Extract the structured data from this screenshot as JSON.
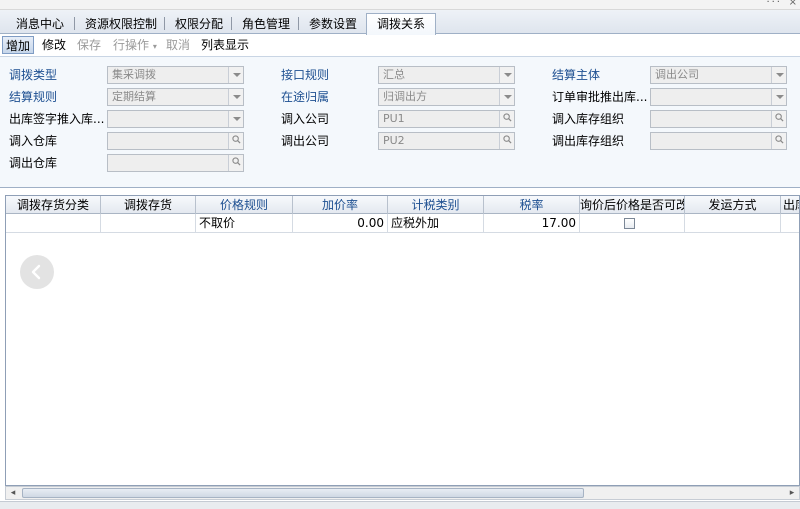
{
  "tabs": [
    {
      "label": "消息中心"
    },
    {
      "label": "资源权限控制"
    },
    {
      "label": "权限分配"
    },
    {
      "label": "角色管理"
    },
    {
      "label": "参数设置"
    },
    {
      "label": "调拨关系",
      "active": true
    }
  ],
  "toolbar": {
    "add": "增加",
    "modify": "修改",
    "save": "保存",
    "row_ops": "行操作",
    "cancel": "取消",
    "list_view": "列表显示"
  },
  "form": {
    "transfer_type": {
      "label": "调拨类型",
      "value": "集采调拨"
    },
    "interface_rule": {
      "label": "接口规则",
      "value": "汇总"
    },
    "settle_subject": {
      "label": "结算主体",
      "value": "调出公司"
    },
    "settle_rule": {
      "label": "结算规则",
      "value": "定期结算"
    },
    "in_transit": {
      "label": "在途归属",
      "value": "归调出方"
    },
    "order_push": {
      "label": "订单审批推出库...",
      "value": ""
    },
    "out_sign_push": {
      "label": "出库签字推入库...",
      "value": ""
    },
    "in_company": {
      "label": "调入公司",
      "value": "PU1"
    },
    "in_stock_org": {
      "label": "调入库存组织",
      "value": ""
    },
    "in_warehouse": {
      "label": "调入仓库",
      "value": ""
    },
    "out_company": {
      "label": "调出公司",
      "value": "PU2"
    },
    "out_stock_org": {
      "label": "调出库存组织",
      "value": ""
    },
    "out_warehouse": {
      "label": "调出仓库",
      "value": ""
    }
  },
  "grid": {
    "columns": [
      "调拨存货分类",
      "调拨存货",
      "价格规则",
      "加价率",
      "计税类别",
      "税率",
      "询价后价格是否可改",
      "发运方式",
      "出库"
    ],
    "rows": [
      {
        "category": "",
        "item": "",
        "price_rule": "不取价",
        "markup": "0.00",
        "tax_type": "应税外加",
        "tax_rate": "17.00",
        "editable_after_quote": false,
        "ship_method": ""
      }
    ]
  },
  "colors": {
    "label_blue": "#1d4f91",
    "panel_bg": "#f4f8fc",
    "disabled_text": "#8a8a8a"
  },
  "icons": {
    "dropdown": "chevron-down-icon",
    "lookup": "magnifier-icon",
    "prev": "chevron-left-icon"
  }
}
